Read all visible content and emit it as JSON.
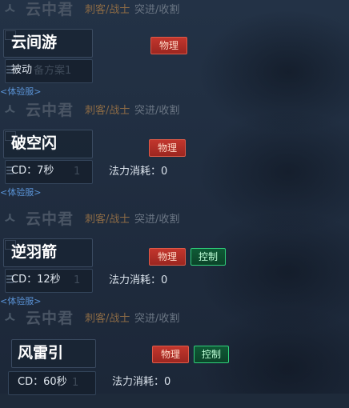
{
  "hero": {
    "name": "云中君",
    "roles": "刺客/战士",
    "tags": "突进/收割"
  },
  "colors": {
    "physical_tag": "#b12f27",
    "control_tag": "#0d5030",
    "control_border": "#2fd07a",
    "link": "#5a93d6",
    "role_text": "#8b6a45"
  },
  "panels": [
    {
      "skill_name": "云间游",
      "info_text": "被动",
      "ghost_text": "备方案1",
      "mana_text": "",
      "physical_tag": "物理",
      "control_tag": "",
      "server_link": "<体验服>"
    },
    {
      "skill_name": "破空闪",
      "info_text": "CD：7秒",
      "ghost_text": "1",
      "mana_text": "法力消耗：0",
      "physical_tag": "物理",
      "control_tag": "",
      "server_link": "<体验服>"
    },
    {
      "skill_name": "逆羽箭",
      "info_text": "CD：12秒",
      "ghost_text": "1",
      "mana_text": "法力消耗：0",
      "physical_tag": "物理",
      "control_tag": "控制",
      "server_link": "<体验服>"
    },
    {
      "skill_name": "风雷引",
      "info_text": "CD：60秒",
      "ghost_text": "1",
      "mana_text": "法力消耗：0",
      "physical_tag": "物理",
      "control_tag": "控制",
      "server_link": ""
    }
  ]
}
